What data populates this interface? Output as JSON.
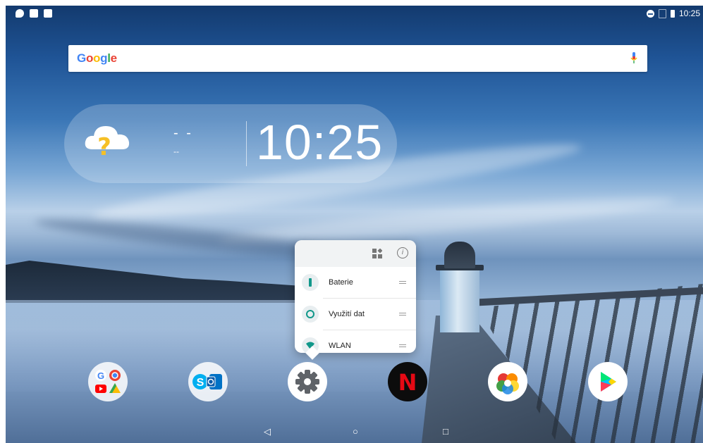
{
  "status_bar": {
    "time": "10:25",
    "notification_icons": [
      "cloud-icon",
      "image-icon",
      "keyboard-icon"
    ],
    "system_icons": [
      "do-not-disturb-icon",
      "no-sim-icon",
      "battery-icon"
    ]
  },
  "search_bar": {
    "logo": "Google",
    "logo_colors": [
      "#4285F4",
      "#EA4335",
      "#FBBC05",
      "#4285F4",
      "#34A853",
      "#EA4335"
    ]
  },
  "weather_widget": {
    "temperature": "- -",
    "location": "--",
    "time": "10:25"
  },
  "app_shortcut_popup": {
    "items": [
      {
        "label": "Baterie",
        "icon": "battery-icon"
      },
      {
        "label": "Využití dat",
        "icon": "data-usage-icon"
      },
      {
        "label": "WLAN",
        "icon": "wifi-icon"
      }
    ]
  },
  "dock": {
    "apps": [
      {
        "name": "google-apps-folder"
      },
      {
        "name": "skype-outlook-folder"
      },
      {
        "name": "settings"
      },
      {
        "name": "netflix",
        "glyph": "N"
      },
      {
        "name": "photos"
      },
      {
        "name": "play-store"
      }
    ]
  },
  "nav_bar": {
    "back": "◁",
    "home": "○",
    "recents": "□"
  },
  "colors": {
    "accent": "#2f6fb3",
    "netflix_red": "#E50914",
    "teal": "#11988a"
  }
}
